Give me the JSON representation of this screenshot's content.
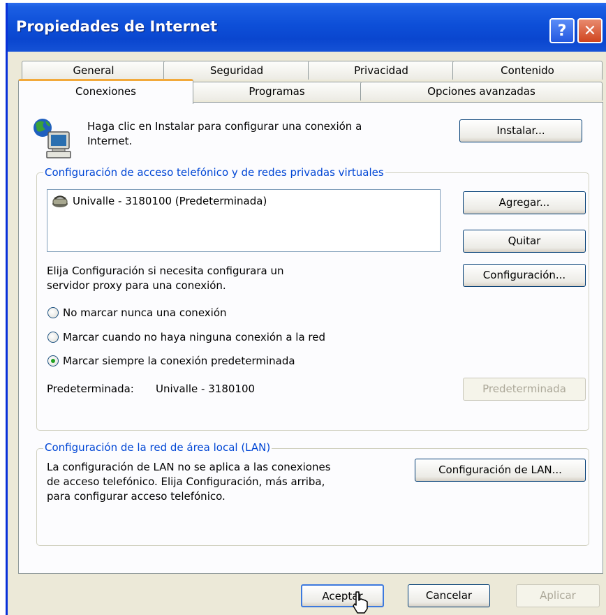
{
  "window": {
    "title": "Propiedades de Internet",
    "help_glyph": "?",
    "close_glyph": "✕"
  },
  "tabs": {
    "row1": [
      "General",
      "Seguridad",
      "Privacidad",
      "Contenido"
    ],
    "row2": [
      "Conexiones",
      "Programas",
      "Opciones avanzadas"
    ],
    "active": "Conexiones"
  },
  "setup": {
    "text_line1": "Haga clic en Instalar para configurar una conexión a",
    "text_line2": "Internet.",
    "install_button": "Instalar..."
  },
  "dialup": {
    "legend": "Configuración de acceso telefónico y de redes privadas virtuales",
    "connections": [
      "Univalle - 3180100 (Predeterminada)"
    ],
    "add_button": "Agregar...",
    "remove_button": "Quitar",
    "settings_button": "Configuración...",
    "proxy_text_line1": "Elija Configuración si necesita configurara un",
    "proxy_text_line2": "servidor proxy para una conexión.",
    "radio_options": [
      {
        "label": "No marcar nunca una conexión",
        "checked": false
      },
      {
        "label": "Marcar cuando no haya ninguna conexión a la red",
        "checked": false
      },
      {
        "label": "Marcar siempre la conexión predeterminada",
        "checked": true
      }
    ],
    "default_label": "Predeterminada:",
    "default_value": "Univalle - 3180100",
    "set_default_button": "Predeterminada"
  },
  "lan": {
    "legend": "Configuración de la red de área local (LAN)",
    "text_line1": "La configuración de LAN no se aplica a las conexiones",
    "text_line2": "de acceso telefónico. Elija Configuración, más arriba,",
    "text_line3": "para configurar acceso telefónico.",
    "settings_button": "Configuración de LAN..."
  },
  "footer": {
    "ok": "Aceptar",
    "cancel": "Cancelar",
    "apply": "Aplicar"
  },
  "colors": {
    "title_bar": "#0a46cf",
    "group_legend": "#0046d5",
    "active_tab_accent": "#f2a93b",
    "dialog_bg": "#ece9d8"
  }
}
